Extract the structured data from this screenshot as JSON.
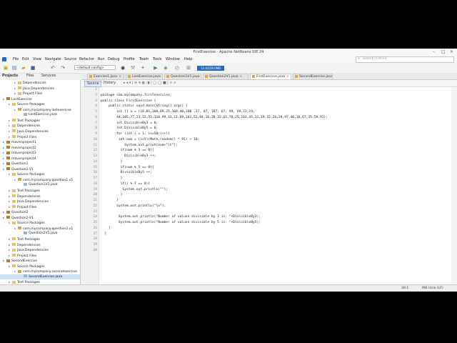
{
  "window": {
    "title": "FirstExercise - Apache NetBeans IDE 24"
  },
  "menu": [
    "File",
    "Edit",
    "View",
    "Navigate",
    "Source",
    "Refactor",
    "Run",
    "Debug",
    "Profile",
    "Team",
    "Tools",
    "Window",
    "Help"
  ],
  "search": {
    "placeholder": "Search (Ctrl+I)"
  },
  "toolbar": {
    "config": "<default config>",
    "memory": "12.4/228.0MB"
  },
  "project_tabs": [
    "Projects",
    "Files",
    "Services"
  ],
  "tree": [
    {
      "label": "Dependencies",
      "indent": 2,
      "icon": "fold"
    },
    {
      "label": "Java Dependencies",
      "indent": 2,
      "icon": "fold"
    },
    {
      "label": "Project Files",
      "indent": 2,
      "icon": "fold"
    },
    {
      "label": "LastExercise",
      "indent": 0,
      "icon": "proj"
    },
    {
      "label": "Source Packages",
      "indent": 1,
      "icon": "fold"
    },
    {
      "label": "com.mycompany.lastexercise",
      "indent": 2,
      "icon": "pkg"
    },
    {
      "label": "LastExercise.java",
      "indent": 3,
      "icon": "java"
    },
    {
      "label": "Test Packages",
      "indent": 1,
      "icon": "fold"
    },
    {
      "label": "Dependencies",
      "indent": 1,
      "icon": "fold"
    },
    {
      "label": "Java Dependencies",
      "indent": 1,
      "icon": "fold"
    },
    {
      "label": "Project Files",
      "indent": 1,
      "icon": "fold"
    },
    {
      "label": "mavenproject1",
      "indent": 0,
      "icon": "proj"
    },
    {
      "label": "mavenproject2",
      "indent": 0,
      "icon": "proj"
    },
    {
      "label": "mavenproject3",
      "indent": 0,
      "icon": "proj"
    },
    {
      "label": "mavenproject4",
      "indent": 0,
      "icon": "proj"
    },
    {
      "label": "Question1",
      "indent": 0,
      "icon": "proj"
    },
    {
      "label": "Question1-V1",
      "indent": 0,
      "icon": "proj"
    },
    {
      "label": "Source Packages",
      "indent": 1,
      "icon": "fold"
    },
    {
      "label": "com.mycompany.question1.v1",
      "indent": 2,
      "icon": "pkg"
    },
    {
      "label": "Question1V1.java",
      "indent": 3,
      "icon": "java"
    },
    {
      "label": "Test Packages",
      "indent": 1,
      "icon": "fold"
    },
    {
      "label": "Dependencies",
      "indent": 1,
      "icon": "fold"
    },
    {
      "label": "Java Dependencies",
      "indent": 1,
      "icon": "fold"
    },
    {
      "label": "Project Files",
      "indent": 1,
      "icon": "fold"
    },
    {
      "label": "Question2",
      "indent": 0,
      "icon": "proj"
    },
    {
      "label": "Question2-V1",
      "indent": 0,
      "icon": "proj"
    },
    {
      "label": "Source Packages",
      "indent": 1,
      "icon": "fold"
    },
    {
      "label": "com.mycompany.question2.v1",
      "indent": 2,
      "icon": "pkg"
    },
    {
      "label": "Question2V1.java",
      "indent": 3,
      "icon": "java"
    },
    {
      "label": "Test Packages",
      "indent": 1,
      "icon": "fold"
    },
    {
      "label": "Dependencies",
      "indent": 1,
      "icon": "fold"
    },
    {
      "label": "Java Dependencies",
      "indent": 1,
      "icon": "fold"
    },
    {
      "label": "Project Files",
      "indent": 1,
      "icon": "fold"
    },
    {
      "label": "SecondExercise",
      "indent": 0,
      "icon": "proj"
    },
    {
      "label": "Source Packages",
      "indent": 1,
      "icon": "fold"
    },
    {
      "label": "com.mycompany.secondexercise",
      "indent": 2,
      "icon": "pkg"
    },
    {
      "label": "SecondExercise.java",
      "indent": 3,
      "icon": "java",
      "selected": true
    },
    {
      "label": "Test Packages",
      "indent": 1,
      "icon": "fold"
    }
  ],
  "editor_tabs": [
    {
      "label": "Exercise1.java"
    },
    {
      "label": "LastExercise.java"
    },
    {
      "label": "Question1V1.java"
    },
    {
      "label": "Question2V1.java"
    },
    {
      "label": "FirstExercise.java",
      "active": true
    },
    {
      "label": "SecondExercise.java"
    }
  ],
  "editor_subtabs": [
    "Source",
    "History"
  ],
  "code": [
    "",
    "package com.mycompany.firstexercise;",
    "public class FirstExercise {",
    "    public static void main(String[] args) {",
    "        int [] a = {18,01,100,89,25,104,40,100 ,37, 07, 107, 67, 99, 69,23,19,",
    "        44,105,77,23,22,55,110,99,33,11,69,101,52,84,16,30,32,65,70,25,102,45,11,19,32,26,20,97,40,10,67,35,59,91};",
    "        int DivisibleBy3 = 0;",
    "        int DivisibleBy5 = 0;",
    "        for (int i = 1; i<=50;i++){",
    "         int num = (int)(Math.random() * 91) + 10;",
    "            System.out.print(num+\"\\t\");",
    "          if(num % 3 == 0){",
    "            DivisibleBy3 ++;",
    "          }",
    "          if(num % 5 == 0){",
    "          DivisibleBy5 ++;",
    "          }",
    "          if(i % 7 == 0){",
    "           System.out.println(\"\");",
    "          }",
    "        }",
    "        System.out.println(\"\\n\");",
    "",
    "         System.out.println(\"Number of values divisible by 3 is: \"+DivisibleBy3);",
    "         System.out.println(\"Number of values divisible by 5 is: \"+DivisibleBy5);",
    "    }",
    "  }",
    "",
    "",
    ""
  ],
  "status": {
    "position": "30:1",
    "mode": "INS Unix (LF)"
  }
}
